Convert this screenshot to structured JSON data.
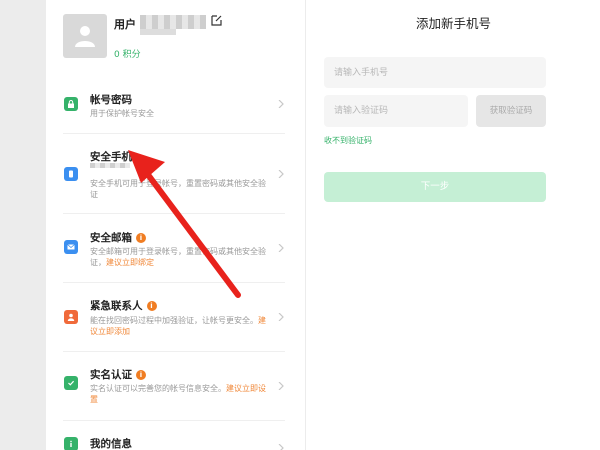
{
  "profile": {
    "username_prefix": "用户",
    "points": "0 积分"
  },
  "security_items": [
    {
      "title": "帐号密码",
      "desc": "用于保护帐号安全",
      "link": "",
      "badge": "",
      "icon": "lock-icon",
      "color": "#35b26a"
    },
    {
      "title": "安全手机",
      "desc": "安全手机可用于登录帐号，重置密码或其他安全验证",
      "link": "",
      "badge": "",
      "icon": "phone-icon",
      "color": "#3b8ff0"
    },
    {
      "title": "安全邮箱",
      "desc": "安全邮箱可用于登录帐号，重置密码或其他安全验证，",
      "link": "建议立即绑定",
      "badge": "i",
      "icon": "mail-icon",
      "color": "#3b8ff0"
    },
    {
      "title": "紧急联系人",
      "desc": "能在找回密码过程中加强验证，让帐号更安全。",
      "link": "建议立即添加",
      "badge": "i",
      "icon": "contact-icon",
      "color": "#f06a3a"
    },
    {
      "title": "实名认证",
      "desc": "实名认证可以完善您的帐号信息安全。",
      "link": "建议立即设置",
      "badge": "i",
      "icon": "verified-icon",
      "color": "#35b26a"
    },
    {
      "title": "我的信息",
      "desc": "",
      "link": "",
      "badge": "",
      "icon": "info-icon",
      "color": "#35b26a"
    }
  ],
  "form": {
    "title": "添加新手机号",
    "phone_placeholder": "请输入手机号",
    "code_placeholder": "请输入验证码",
    "get_code_label": "获取验证码",
    "no_code_label": "收不到验证码",
    "next_label": "下一步"
  },
  "colors": {
    "accent_green": "#35b26a",
    "link_orange": "#f0883a",
    "annotation_red": "#e8221c"
  }
}
